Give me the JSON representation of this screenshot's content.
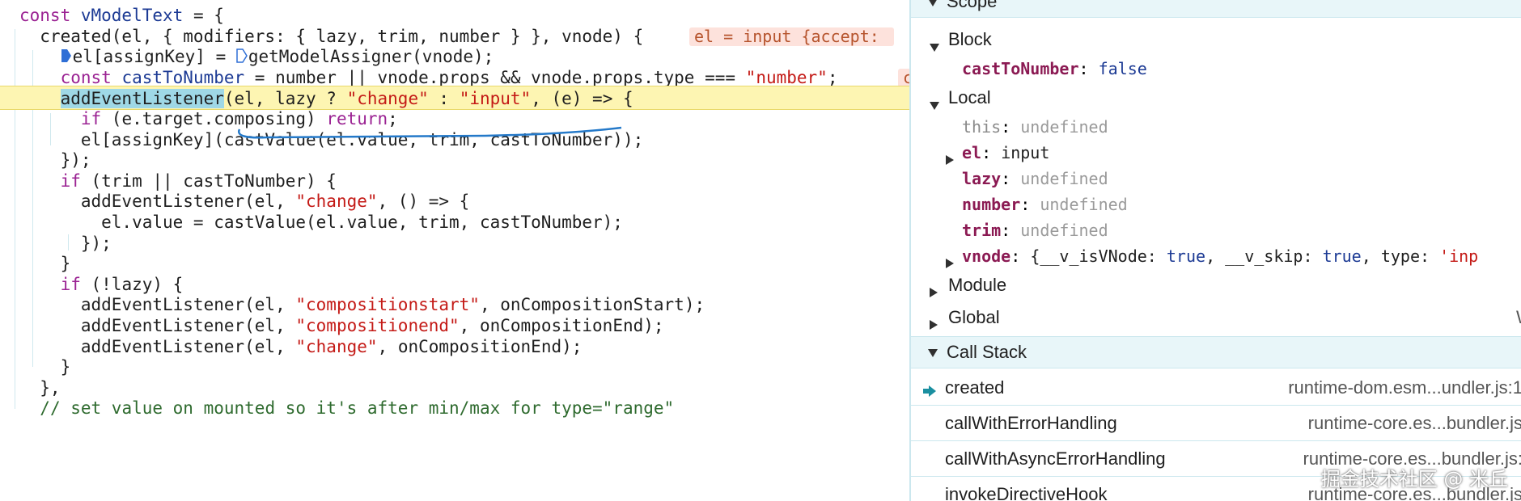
{
  "editor": {
    "lines": [
      {
        "parts": [
          [
            "const ",
            "kw"
          ],
          [
            "vModelText",
            "var"
          ],
          [
            " = {",
            ""
          ]
        ]
      },
      {
        "parts": [
          [
            "  created(el, { modifiers: { lazy, trim, number } }, vnode) {",
            ""
          ]
        ],
        "inline": "el = input {accept: "
      },
      {
        "parts": [
          [
            "    ",
            ""
          ],
          [
            "el[assignKey] = ",
            ""
          ],
          [
            "getModelAssigner(vnode);",
            ""
          ]
        ]
      },
      {
        "parts": [
          [
            "    ",
            ""
          ],
          [
            "const ",
            "kw"
          ],
          [
            "castToNumber",
            "var"
          ],
          [
            " = number || vnode.props && vnode.props.type === ",
            ""
          ],
          [
            "\"number\"",
            "str"
          ],
          [
            ";",
            ""
          ]
        ],
        "inline": "c"
      },
      {
        "parts": [
          [
            "    ",
            ""
          ],
          [
            "addEventListener",
            "hl"
          ],
          [
            "(el, lazy ? ",
            ""
          ],
          [
            "\"change\"",
            "str"
          ],
          [
            " : ",
            ""
          ],
          [
            "\"input\"",
            "str"
          ],
          [
            ", (e) => {",
            ""
          ]
        ]
      },
      {
        "parts": [
          [
            "      ",
            ""
          ],
          [
            "if",
            "kw"
          ],
          [
            " (e.target.composing) ",
            ""
          ],
          [
            "return",
            "kw"
          ],
          [
            ";",
            ""
          ]
        ]
      },
      {
        "parts": [
          [
            "      el[assignKey](castValue(el.value, trim, castToNumber));",
            ""
          ]
        ]
      },
      {
        "parts": [
          [
            "    });",
            ""
          ]
        ]
      },
      {
        "parts": [
          [
            "    ",
            ""
          ],
          [
            "if",
            "kw"
          ],
          [
            " (trim || castToNumber) {",
            ""
          ]
        ]
      },
      {
        "parts": [
          [
            "      addEventListener(el, ",
            ""
          ],
          [
            "\"change\"",
            "str"
          ],
          [
            ", () => {",
            ""
          ]
        ]
      },
      {
        "parts": [
          [
            "        el.value = castValue(el.value, trim, castToNumber);",
            ""
          ]
        ]
      },
      {
        "parts": [
          [
            "      });",
            ""
          ]
        ]
      },
      {
        "parts": [
          [
            "    }",
            ""
          ]
        ]
      },
      {
        "parts": [
          [
            "    ",
            ""
          ],
          [
            "if",
            "kw"
          ],
          [
            " (!lazy) {",
            ""
          ]
        ]
      },
      {
        "parts": [
          [
            "      addEventListener(el, ",
            ""
          ],
          [
            "\"compositionstart\"",
            "str"
          ],
          [
            ", onCompositionStart);",
            ""
          ]
        ]
      },
      {
        "parts": [
          [
            "      addEventListener(el, ",
            ""
          ],
          [
            "\"compositionend\"",
            "str"
          ],
          [
            ", onCompositionEnd);",
            ""
          ]
        ]
      },
      {
        "parts": [
          [
            "      addEventListener(el, ",
            ""
          ],
          [
            "\"change\"",
            "str"
          ],
          [
            ", onCompositionEnd);",
            ""
          ]
        ]
      },
      {
        "parts": [
          [
            "    }",
            ""
          ]
        ]
      },
      {
        "parts": [
          [
            "  },",
            ""
          ]
        ]
      },
      {
        "parts": [
          [
            "  ",
            ""
          ],
          [
            "// set value on mounted so it's after min/max for type=\"range\"",
            "cm"
          ]
        ]
      }
    ]
  },
  "sidebar": {
    "scope_label": "Scope",
    "block": {
      "label": "Block",
      "props": [
        {
          "name": "castToNumber",
          "value": "false",
          "kind": "false"
        }
      ]
    },
    "local": {
      "label": "Local",
      "props": [
        {
          "name": "this",
          "value": "undefined",
          "kind": "undef",
          "dim": true,
          "expandable": false
        },
        {
          "name": "el",
          "value": "input",
          "kind": "plain",
          "expandable": true
        },
        {
          "name": "lazy",
          "value": "undefined",
          "kind": "undef",
          "expandable": false
        },
        {
          "name": "number",
          "value": "undefined",
          "kind": "undef",
          "expandable": false
        },
        {
          "name": "trim",
          "value": "undefined",
          "kind": "undef",
          "expandable": false
        },
        {
          "name": "vnode",
          "value": "{__v_isVNode: true, __v_skip: true, type: 'inp",
          "kind": "plain",
          "expandable": true
        }
      ]
    },
    "module_label": "Module",
    "global_label": "Global",
    "global_value": "W",
    "call_stack_label": "Call Stack",
    "call_stack": [
      {
        "fn": "created",
        "loc": "runtime-dom.esm...undler.js:1",
        "current": true
      },
      {
        "fn": "callWithErrorHandling",
        "loc": "runtime-core.es...bundler.js"
      },
      {
        "fn": "callWithAsyncErrorHandling",
        "loc": "runtime-core.es...bundler.js:"
      },
      {
        "fn": "invokeDirectiveHook",
        "loc": "runtime-core.es...bundler.js"
      }
    ]
  },
  "watermark": "掘金技术社区 @ 米丘",
  "colors": {
    "paused_line": "#fdf5b2",
    "header_bg": "#e8f6f9",
    "accent": "#1a8fa0"
  }
}
